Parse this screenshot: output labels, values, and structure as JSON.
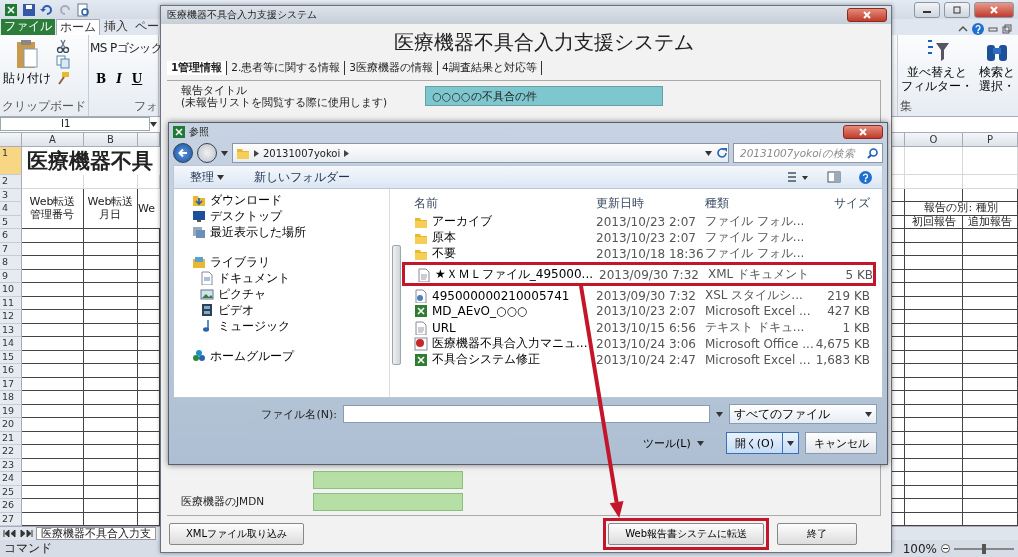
{
  "excel": {
    "tabs": [
      {
        "label": "ファイル",
        "kind": "file",
        "selected": false
      },
      {
        "label": "ホーム",
        "kind": "tab",
        "selected": true
      },
      {
        "label": "挿入",
        "kind": "tab",
        "selected": false
      },
      {
        "label": "ペー",
        "kind": "tab",
        "selected": false
      }
    ],
    "clipboard": {
      "paste_label": "貼り付け",
      "group_label": "クリップボード"
    },
    "font": {
      "name": "MS Pゴシック",
      "styles": [
        "B",
        "I",
        "U"
      ],
      "group_label": "フォ"
    },
    "editing": {
      "sort_lines": [
        "並べ替えと",
        "フィルター・"
      ],
      "find_lines": [
        "検索と",
        "選択・"
      ],
      "group_label": "集"
    },
    "name_box": "I1",
    "column_headers": [
      "A",
      "B",
      "O",
      "P"
    ],
    "row_numbers": [
      "1",
      "2",
      "3",
      "4",
      "5",
      "6",
      "7",
      "8",
      "9",
      "10",
      "11",
      "12",
      "13",
      "14",
      "15",
      "16",
      "17",
      "18",
      "19",
      "20",
      "21",
      "22",
      "23",
      "24",
      "25",
      "26",
      "27"
    ],
    "title_cell": "医療機器不具",
    "left_headers": [
      [
        "Web転送",
        "管理番号"
      ],
      [
        "Web転送",
        "月日"
      ],
      [
        "We"
      ]
    ],
    "group_header": "報告の別: 種別",
    "right_headers": [
      "初回報告",
      "追加報告"
    ],
    "sheet_tab": "医療機器不具合入力支",
    "status": "コマンド",
    "zoom": {
      "label": "100%",
      "level": 0.5
    }
  },
  "app": {
    "title": "医療機器不具合入力支援システム",
    "heading": "医療機器不具合入力支援システム",
    "tabs": [
      {
        "label": "1管理情報",
        "selected": true
      },
      {
        "label": "2.患者等に関する情報",
        "selected": false
      },
      {
        "label": "3医療機器の情報",
        "selected": false
      },
      {
        "label": "4調査結果と対応等",
        "selected": false
      }
    ],
    "report_title": {
      "label_lines": [
        "報告タイトル",
        "(未報告リストを閲覧する際に使用します)"
      ],
      "value": "○○○○の不具合の件"
    },
    "lower_fields": [
      {
        "covered": true
      },
      {
        "covered": false,
        "label": "医療機器のJMDN"
      }
    ],
    "buttons": [
      {
        "label": "XMLファイル取り込み",
        "annotated": false
      },
      {
        "label": "Web報告書システムに転送",
        "annotated": true
      },
      {
        "label": "終了",
        "annotated": false
      }
    ]
  },
  "dialog": {
    "title": "参照",
    "path": [
      "20131007yokoi"
    ],
    "search_placeholder": "20131007yokoiの検索",
    "toolbar": [
      {
        "label": "整理",
        "kind": "menu"
      },
      {
        "label": "新しいフォルダー",
        "kind": "action"
      }
    ],
    "sidebar": [
      {
        "label": "ダウンロード",
        "kind": "download"
      },
      {
        "label": "デスクトップ",
        "kind": "desktop"
      },
      {
        "label": "最近表示した場所",
        "kind": "recent"
      },
      {
        "label": "ライブラリ",
        "kind": "library",
        "children": [
          {
            "label": "ドキュメント",
            "kind": "document"
          },
          {
            "label": "ピクチャ",
            "kind": "picture"
          },
          {
            "label": "ビデオ",
            "kind": "video"
          },
          {
            "label": "ミュージック",
            "kind": "music"
          }
        ]
      },
      {
        "label": "ホームグループ",
        "kind": "homegroup"
      }
    ],
    "columns": [
      "名前",
      "更新日時",
      "種類",
      "サイズ"
    ],
    "files": [
      {
        "name": "アーカイブ",
        "modified": "2013/10/23 2:07",
        "type": "ファイル フォル...",
        "kind": "folder",
        "annotated": false
      },
      {
        "name": "原本",
        "modified": "2013/10/23 2:07",
        "type": "ファイル フォル...",
        "kind": "folder",
        "annotated": false
      },
      {
        "name": "不要",
        "modified": "2013/10/18 18:36",
        "type": "ファイル フォル...",
        "kind": "folder",
        "annotated": false
      },
      {
        "name": "★ＸＭＬファイル_495000...",
        "modified": "2013/09/30 7:32",
        "type": "XML ドキュメント",
        "size": "5 KB",
        "kind": "xml",
        "annotated": true
      },
      {
        "name": "495000000210005741",
        "modified": "2013/09/30 7:32",
        "type": "XSL スタイルシ...",
        "size": "219 KB",
        "kind": "xsl",
        "annotated": false
      },
      {
        "name": "MD_AEvO_○○○",
        "modified": "2013/10/23 2:07",
        "type": "Microsoft Excel ...",
        "size": "427 KB",
        "kind": "excel",
        "annotated": false
      },
      {
        "name": "URL",
        "modified": "2013/10/15 6:56",
        "type": "テキスト ドキュ...",
        "size": "1 KB",
        "kind": "text",
        "annotated": false
      },
      {
        "name": "医療機器不具合入力マニュ...",
        "modified": "2013/10/24 3:06",
        "type": "Microsoft Office ...",
        "size": "4,675 KB",
        "kind": "office",
        "annotated": false
      },
      {
        "name": "不具合システム修正",
        "modified": "2013/10/24 2:47",
        "type": "Microsoft Excel ...",
        "size": "1,683 KB",
        "kind": "excel",
        "annotated": false
      }
    ],
    "filename_label": "ファイル名(N):",
    "filter": "すべてのファイル",
    "tools": "ツール(L)",
    "open": "開く(O)",
    "cancel": "キャンセル"
  }
}
